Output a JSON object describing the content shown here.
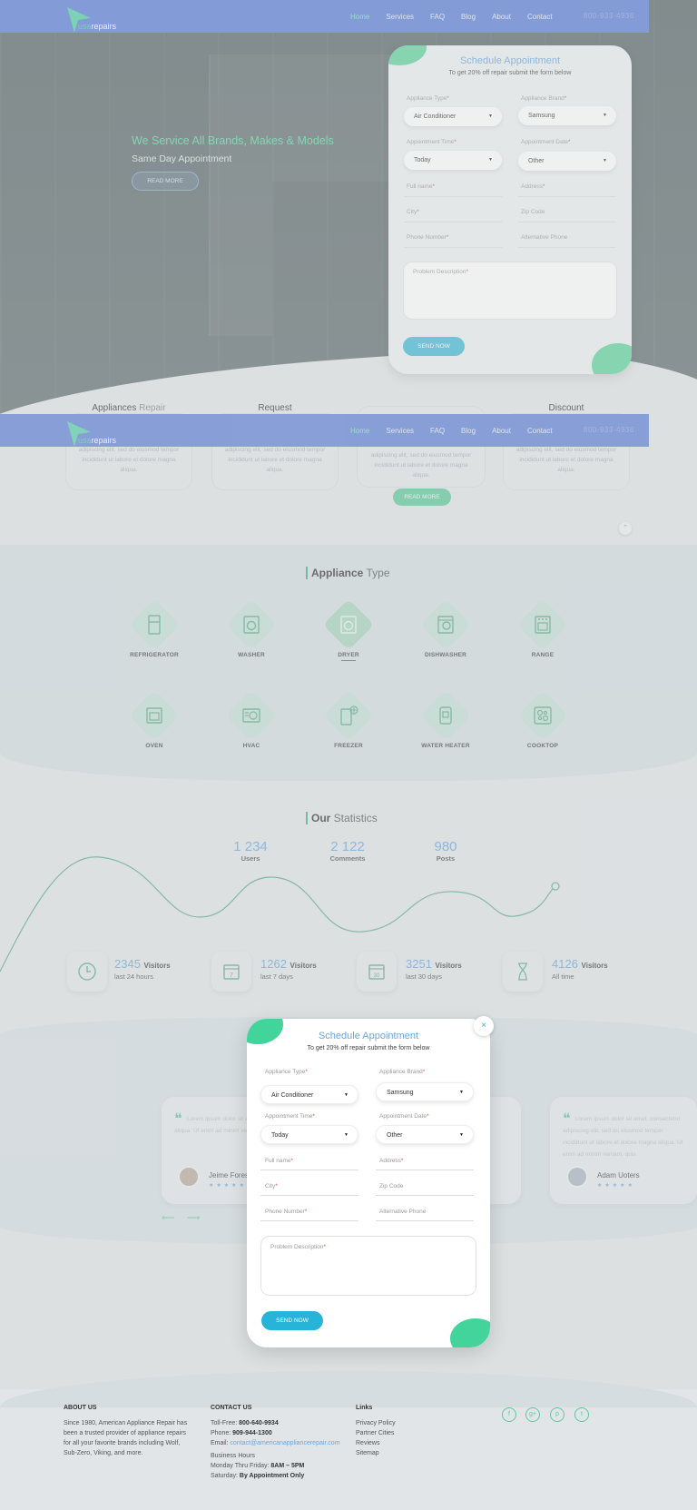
{
  "nav": {
    "logo_prefix": "usa",
    "logo_suffix": "repairs",
    "links": [
      "Home",
      "Services",
      "FAQ",
      "Blog",
      "About",
      "Contact"
    ],
    "phone": "800-933-4936"
  },
  "hero": {
    "title": "We Service All Brands, Makes & Models",
    "subtitle": "Same Day Appointment",
    "button": "READ MORE"
  },
  "form": {
    "title": "Schedule Appointment",
    "subtitle": "To get 20% off repair submit the form below",
    "appliance_type_label": "Appliance Type",
    "appliance_type_value": "Air Conditioner",
    "appliance_brand_label": "Appliance Brand",
    "appliance_brand_value": "Samsung",
    "appointment_time_label": "Appointment Time",
    "appointment_time_value": "Today",
    "appointment_date_label": "Appointment Date",
    "appointment_date_value": "Other",
    "full_name_label": "Full name",
    "address_label": "Address",
    "city_label": "City",
    "zip_label": "Zip Code",
    "phone_label": "Phone Number",
    "alt_phone_label": "Alternative Phone",
    "problem_label": "Problem Description",
    "required_mark": "*",
    "send_button": "SEND NOW"
  },
  "services": {
    "items": [
      {
        "title_strong": "Appliances",
        "title_light": " Repair"
      },
      {
        "title_strong": "Request",
        "title_light": ""
      },
      {
        "title_strong": "Request",
        "title_light": ""
      },
      {
        "title_strong": "Discount",
        "title_light": ""
      }
    ],
    "desc": "adipiscing elit, sed do eiusmod tempor incididunt ut labore et dolore magna aliqua.",
    "button": "READ MORE"
  },
  "appliances": {
    "heading_strong": "Appliance",
    "heading_light": " Type",
    "items": [
      "REFRIGERATOR",
      "WASHER",
      "DRYER",
      "DISHWASHER",
      "RANGE",
      "OVEN",
      "HVAC",
      "FREEZER",
      "WATER HEATER",
      "COOKTOP"
    ]
  },
  "statistics": {
    "heading_strong": "Our",
    "heading_light": " Statistics",
    "top": [
      {
        "value": "1 234",
        "label": "Users"
      },
      {
        "value": "2 122",
        "label": "Comments"
      },
      {
        "value": "980",
        "label": "Posts"
      }
    ],
    "visitors": [
      {
        "value": "2345",
        "unit": "Visitors",
        "period": "last 24 hours",
        "icon": "clock-icon"
      },
      {
        "value": "1262",
        "unit": "Visitors",
        "period": "last 7 days",
        "icon": "calendar-week-icon"
      },
      {
        "value": "3251",
        "unit": "Visitors",
        "period": "last 30 days",
        "icon": "calendar-month-icon"
      },
      {
        "value": "4126",
        "unit": "Visitors",
        "period": "All time",
        "icon": "hourglass-icon"
      }
    ]
  },
  "testimonials": {
    "left_text": "Lorem ipsum dolor sit amet, consectetur adipiscing elit, sed do eiusmod tempor incididunt ut labore et dolore magna aliqua. Ut enim ad minim veniam, quis",
    "left_name": "Jeime Forest",
    "right_text": "Lorem ipsum dolor sit amet, consectetur adipiscing elit, sed do eiusmod tempor incididunt ut labore et dolore magna aliqua. Ut enim ad minim veniam, quis",
    "right_name": "Adam Uoters",
    "stars": "★★★★★",
    "prev": "⟵",
    "next": "⟶"
  },
  "popup": {
    "close": "×"
  },
  "footer": {
    "about_title": "ABOUT US",
    "about_text": "Since 1980, American Appliance Repair has been a trusted provider of appliance repairs for all your favorite brands including Wolf, Sub-Zero, Viking, and more.",
    "contact_title": "CONTACT US",
    "tollfree_label": "Toll-Free: ",
    "tollfree": "800-640-9934",
    "phone_label": "Phone: ",
    "phone": "909-944-1300",
    "email_label": "Email: ",
    "email": "contact@americanappliancerepair.com",
    "hours_title": "Business Hours",
    "hours_week_label": "Monday Thru Friday: ",
    "hours_week": "8AM – 5PM",
    "hours_sat_label": "Saturday: ",
    "hours_sat": "By Appointment Only",
    "links_title": "Links",
    "links": [
      "Privacy Policy",
      "Partner Cities",
      "Reviews",
      "Sitemap"
    ],
    "social": [
      "f",
      "g+",
      "p",
      "t"
    ]
  },
  "colors": {
    "accent_green": "#5ec89c",
    "accent_blue": "#6aa6de",
    "nav_blue": "#5a7bd6",
    "send_blue": "#27b4d8"
  }
}
